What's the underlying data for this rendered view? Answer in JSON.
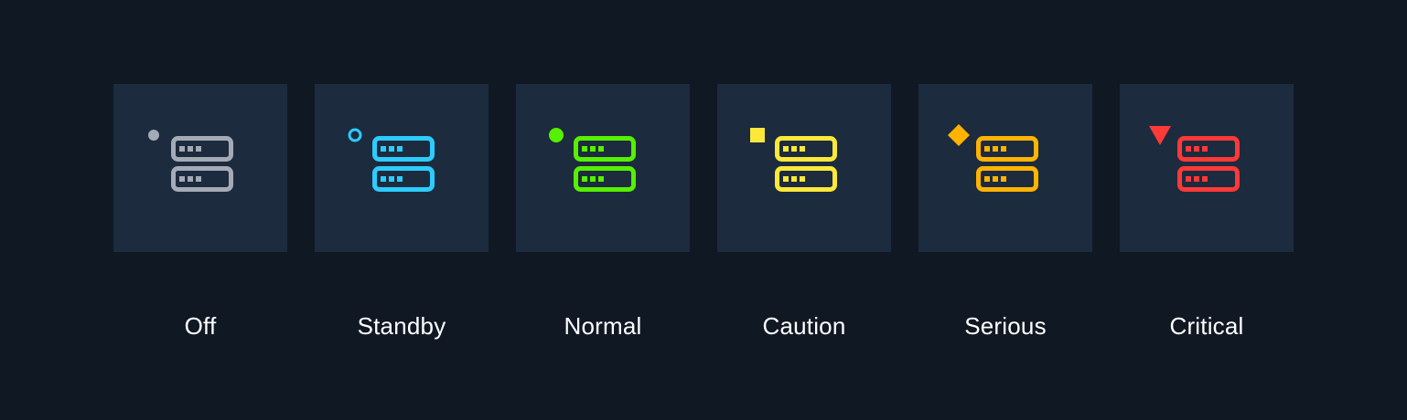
{
  "statuses": [
    {
      "label": "Off",
      "color": "#a4abb6",
      "indicator": "small-dot-icon",
      "icon": "server-icon"
    },
    {
      "label": "Standby",
      "color": "#2dccff",
      "indicator": "ring-icon",
      "icon": "server-icon"
    },
    {
      "label": "Normal",
      "color": "#56f000",
      "indicator": "filled-circle-icon",
      "icon": "server-icon"
    },
    {
      "label": "Caution",
      "color": "#fce83a",
      "indicator": "square-icon",
      "icon": "server-icon"
    },
    {
      "label": "Serious",
      "color": "#ffb302",
      "indicator": "diamond-icon",
      "icon": "server-icon"
    },
    {
      "label": "Critical",
      "color": "#ff3838",
      "indicator": "triangle-down-icon",
      "icon": "server-icon"
    }
  ]
}
